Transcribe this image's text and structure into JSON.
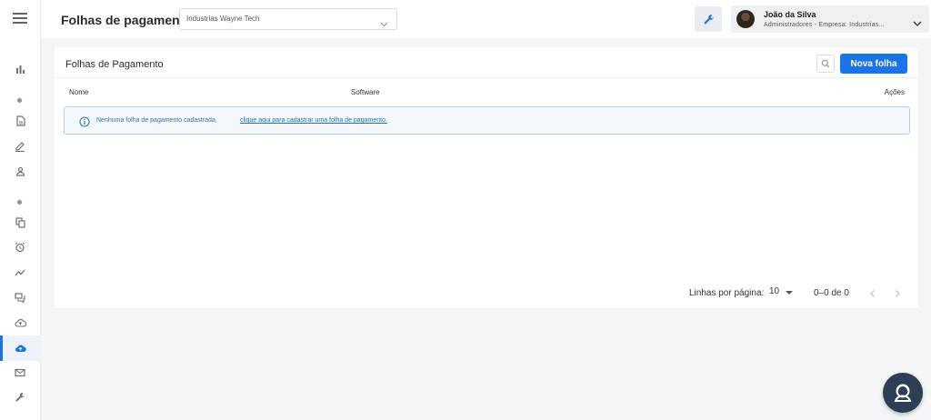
{
  "header": {
    "page_title": "Folhas de pagamento",
    "company_select": "Industrias Wayne Tech",
    "tool_icon": "wrench-icon",
    "user": {
      "name": "João da Silva",
      "role": "Administradores - Empresa: Industrias..."
    }
  },
  "sidebar": {
    "items": [
      {
        "icon": "bar-chart-icon"
      },
      {
        "icon": "document-icon"
      },
      {
        "icon": "edit-icon"
      },
      {
        "icon": "user-icon"
      },
      {
        "icon": "copy-icon"
      },
      {
        "icon": "alarm-icon"
      },
      {
        "icon": "trend-icon"
      },
      {
        "icon": "chat-icon"
      },
      {
        "icon": "cloud-upload-icon"
      },
      {
        "icon": "cloud-upload-icon",
        "active": true
      },
      {
        "icon": "mail-icon"
      },
      {
        "icon": "wrench-icon"
      }
    ]
  },
  "card": {
    "title": "Folhas de Pagamento",
    "new_button": "Nova folha",
    "columns": {
      "nome": "Nome",
      "software": "Software",
      "acoes": "Ações"
    },
    "empty_message": "Nenhuma folha de pagamento cadastrada,",
    "empty_link": "clique aqui para cadastrar uma folha de pagamento."
  },
  "pagination": {
    "rows_label": "Linhas por página:",
    "rows_per_page": "10",
    "range": "0–0 de 0"
  },
  "colors": {
    "accent": "#1a73e8",
    "alert_border": "#b8cde2",
    "alert_bg": "#f3f8fd",
    "help_fab": "#2d3e57"
  }
}
